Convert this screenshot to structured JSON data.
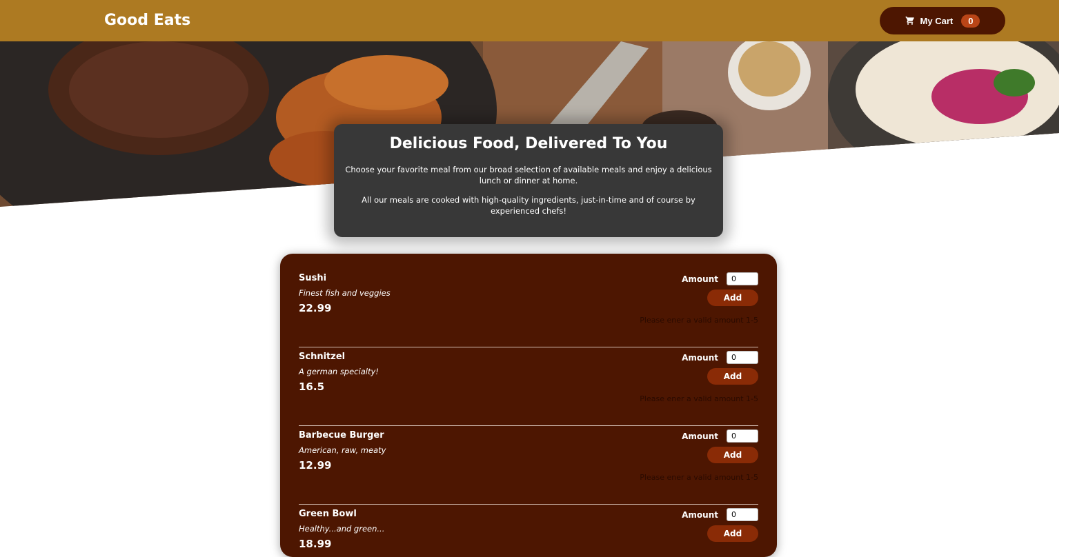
{
  "header": {
    "brand": "Good Eats",
    "cart_label": "My Cart",
    "cart_count": "0",
    "cart_icon": "shopping-cart-icon"
  },
  "hero": {
    "image": "food-table-banner"
  },
  "summary": {
    "title": "Delicious Food, Delivered To You",
    "paragraph_1": "Choose your favorite meal from our broad selection of available meals and enjoy a delicious lunch or dinner at home.",
    "paragraph_2": "All our meals are cooked with high-quality ingredients, just-in-time and of course by experienced chefs!"
  },
  "meals": {
    "amount_label": "Amount",
    "add_label": "Add",
    "error_text": "Please ener a valid amount 1-5",
    "items": [
      {
        "name": "Sushi",
        "description": "Finest fish and veggies",
        "price": "22.99",
        "amount": "0"
      },
      {
        "name": "Schnitzel",
        "description": "A german specialty!",
        "price": "16.5",
        "amount": "0"
      },
      {
        "name": "Barbecue Burger",
        "description": "American, raw, meaty",
        "price": "12.99",
        "amount": "0"
      },
      {
        "name": "Green Bowl",
        "description": "Healthy...and green...",
        "price": "18.99",
        "amount": "0"
      }
    ]
  },
  "colors": {
    "header_bg": "#ad7a22",
    "cart_bg": "#4d1601",
    "badge_bg": "#b94517",
    "summary_bg": "#383838",
    "meals_bg": "#4d1601",
    "add_bg": "#8a2b06"
  }
}
